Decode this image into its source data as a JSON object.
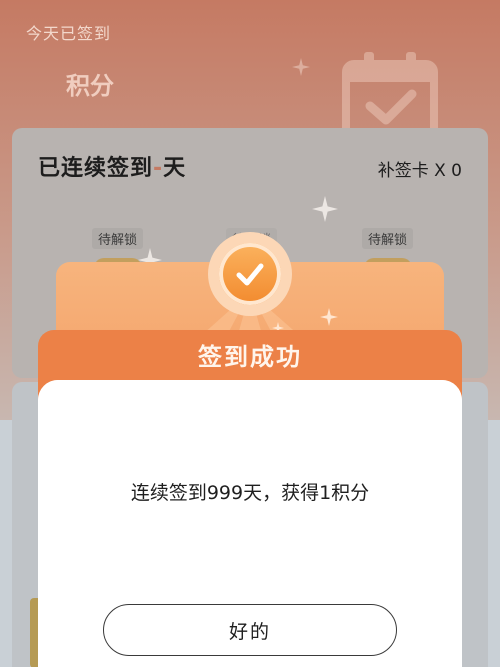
{
  "background": {
    "top_label": "今天已签到",
    "points_label": "积分",
    "streak_title_prefix": "已连续签到",
    "streak_title_dash": "-",
    "streak_title_suffix": "天",
    "makeup_card": "补签卡 X 0",
    "unlock_tags": [
      "待解锁",
      "待解锁",
      "待解锁"
    ]
  },
  "modal": {
    "title": "签到成功",
    "message": "连续签到999天，获得1积分",
    "ok_label": "好的"
  },
  "icons": {
    "calendar": "calendar-check-icon",
    "success": "check-circle-icon",
    "sparkle": "sparkle-icon"
  },
  "colors": {
    "accent_orange": "#f39f66",
    "flap_orange": "#ec8147",
    "badge_orange": "#f28a2e",
    "header_tint": "#c57a63"
  }
}
